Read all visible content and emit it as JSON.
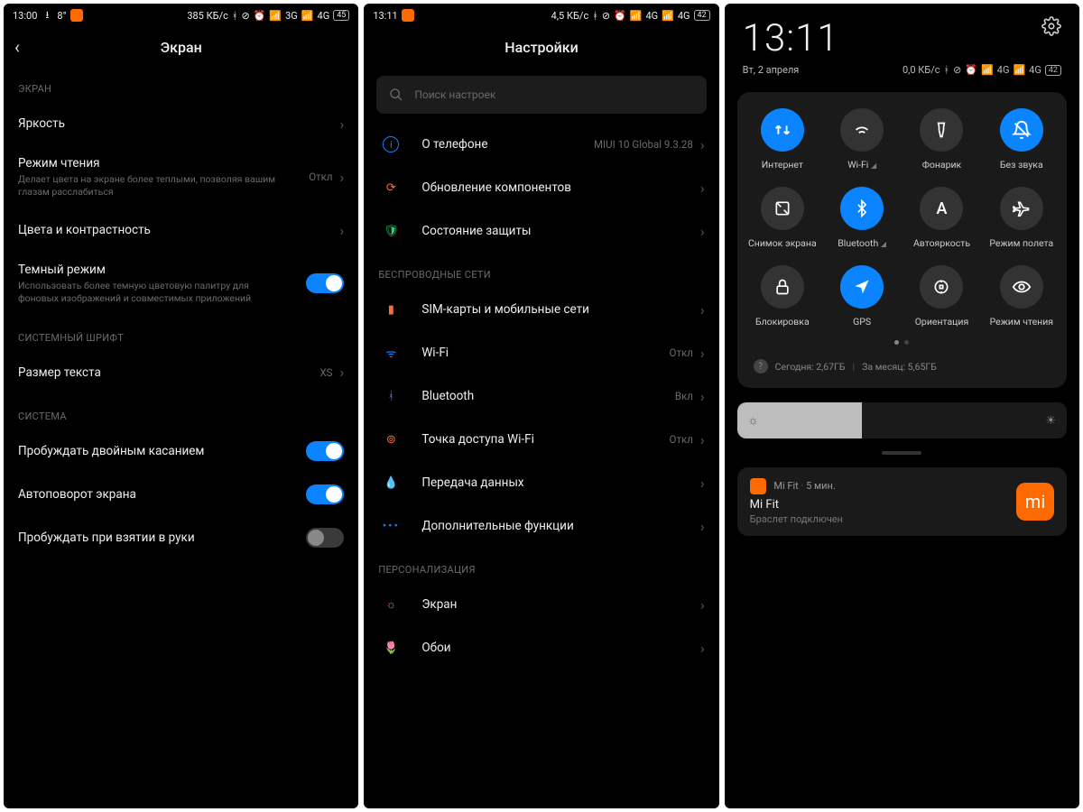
{
  "screen1": {
    "status": {
      "time": "13:00",
      "temp": "8°",
      "speed": "385 КБ/с",
      "net1": "3G",
      "net2": "4G",
      "batt": "45"
    },
    "title": "Экран",
    "sec1": "ЭКРАН",
    "brightness": "Яркость",
    "reading": {
      "t": "Режим чтения",
      "sub": "Делает цвета на экране более теплыми, позволяя вашим глазам расслабиться",
      "v": "Откл"
    },
    "colors": "Цвета и контрастность",
    "dark": {
      "t": "Темный режим",
      "sub": "Использовать более темную цветовую палитру для фоновых изображений и совместимых приложений"
    },
    "sec2": "СИСТЕМНЫЙ ШРИФТ",
    "textsize": {
      "t": "Размер текста",
      "v": "XS"
    },
    "sec3": "СИСТЕМА",
    "doubletap": "Пробуждать двойным касанием",
    "autorotate": "Автоповорот экрана",
    "raisewake": "Пробуждать при взятии в руки"
  },
  "screen2": {
    "status": {
      "time": "13:11",
      "speed": "4,5 КБ/с",
      "net1": "4G",
      "net2": "4G",
      "batt": "42"
    },
    "title": "Настройки",
    "search_ph": "Поиск настроек",
    "about": {
      "t": "О телефоне",
      "v": "MIUI 10 Global 9.3.28"
    },
    "update": "Обновление компонентов",
    "security": "Состояние защиты",
    "sec_wireless": "БЕСПРОВОДНЫЕ СЕТИ",
    "sim": "SIM-карты и мобильные сети",
    "wifi": {
      "t": "Wi-Fi",
      "v": "Откл"
    },
    "bt": {
      "t": "Bluetooth",
      "v": "Вкл"
    },
    "hotspot": {
      "t": "Точка доступа Wi-Fi",
      "v": "Откл"
    },
    "data": "Передача данных",
    "more": "Дополнительные функции",
    "sec_pers": "ПЕРСОНАЛИЗАЦИЯ",
    "display": "Экран",
    "wallpaper": "Обои"
  },
  "screen3": {
    "clock": "13:11",
    "date": "Вт, 2 апреля",
    "status": {
      "speed": "0,0 КБ/с",
      "net1": "4G",
      "net2": "4G",
      "batt": "42"
    },
    "tiles": [
      {
        "label": "Интернет",
        "on": true,
        "icon": "data"
      },
      {
        "label": "Wi-Fi",
        "on": false,
        "icon": "wifi",
        "tri": true
      },
      {
        "label": "Фонарик",
        "on": false,
        "icon": "torch"
      },
      {
        "label": "Без звука",
        "on": true,
        "icon": "mute"
      },
      {
        "label": "Снимок экрана",
        "on": false,
        "icon": "screenshot"
      },
      {
        "label": "Bluetooth",
        "on": true,
        "icon": "bt",
        "tri": true
      },
      {
        "label": "Автояркость",
        "on": false,
        "icon": "autob"
      },
      {
        "label": "Режим полета",
        "on": false,
        "icon": "plane"
      },
      {
        "label": "Блокировка",
        "on": false,
        "icon": "lock"
      },
      {
        "label": "GPS",
        "on": true,
        "icon": "gps"
      },
      {
        "label": "Ориентация",
        "on": false,
        "icon": "orient"
      },
      {
        "label": "Режим чтения",
        "on": false,
        "icon": "read"
      }
    ],
    "usage": {
      "today": "Сегодня: 2,67ГБ",
      "month": "За месяц: 5,65ГБ"
    },
    "notif": {
      "app": "Mi Fit",
      "age": "5 мин.",
      "title": "Mi Fit",
      "sub": "Браслет подключен"
    }
  }
}
